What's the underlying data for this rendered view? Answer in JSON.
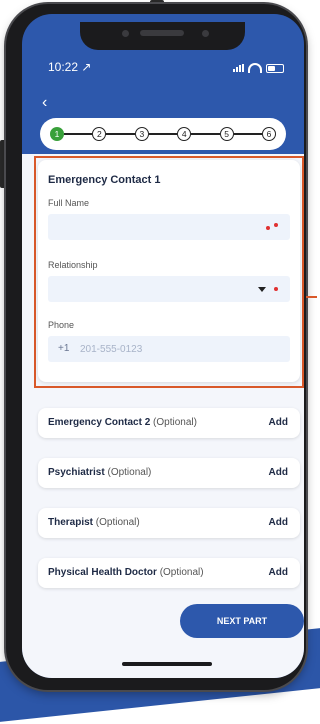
{
  "status": {
    "time": "10:22"
  },
  "icons": {
    "location": "location-arrow-icon",
    "signal": "signal-icon",
    "wifi": "wifi-icon",
    "battery": "battery-icon",
    "back": "chevron-left-icon",
    "caret": "caret-down-icon"
  },
  "stepper": {
    "steps": [
      "1",
      "2",
      "3",
      "4",
      "5",
      "6"
    ],
    "active_step": 1
  },
  "emergency_contact_1": {
    "title": "Emergency Contact 1",
    "full_name_label": "Full Name",
    "relationship_label": "Relationship",
    "phone_label": "Phone",
    "phone_prefix": "+1",
    "phone_placeholder": "201-555-0123"
  },
  "sections": [
    {
      "name": "Emergency Contact 2",
      "optional": "(Optional)",
      "action": "Add"
    },
    {
      "name": "Psychiatrist",
      "optional": "(Optional)",
      "action": "Add"
    },
    {
      "name": "Therapist",
      "optional": "(Optional)",
      "action": "Add"
    },
    {
      "name": "Physical Health Doctor",
      "optional": "(Optional)",
      "action": "Add"
    }
  ],
  "next_button": {
    "label": "NEXT PART"
  },
  "colors": {
    "brand_blue": "#2d58ac",
    "active_step": "#39a03a",
    "required": "#e03131",
    "highlight": "#d9592a"
  }
}
